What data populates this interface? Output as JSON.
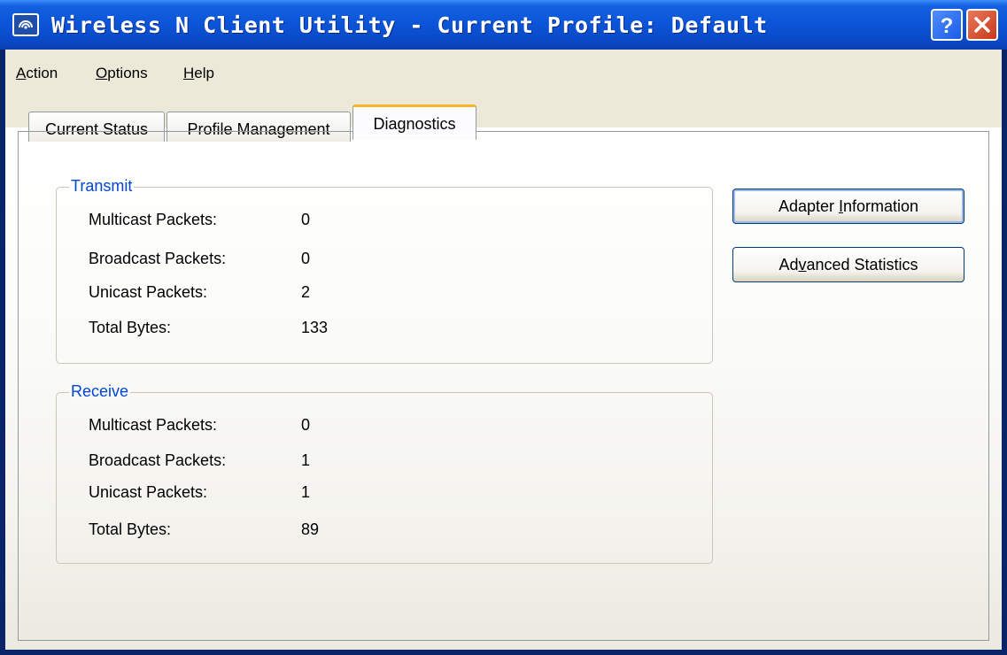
{
  "window": {
    "title": "Wireless N Client Utility - Current Profile: Default"
  },
  "menubar": [
    {
      "pre": "",
      "ul": "A",
      "post": "ction"
    },
    {
      "pre": "",
      "ul": "O",
      "post": "ptions"
    },
    {
      "pre": "",
      "ul": "H",
      "post": "elp"
    }
  ],
  "tabs": [
    "Current Status",
    "Profile Management",
    "Diagnostics"
  ],
  "active_tab": "Diagnostics",
  "transmit": {
    "legend": "Transmit",
    "rows": [
      {
        "label": "Multicast Packets:",
        "value": "0"
      },
      {
        "label": "Broadcast Packets:",
        "value": "0"
      },
      {
        "label": "Unicast Packets:",
        "value": "2"
      },
      {
        "label": "Total Bytes:",
        "value": "133"
      }
    ]
  },
  "receive": {
    "legend": "Receive",
    "rows": [
      {
        "label": "Multicast Packets:",
        "value": "0"
      },
      {
        "label": "Broadcast Packets:",
        "value": "1"
      },
      {
        "label": "Unicast Packets:",
        "value": "1"
      },
      {
        "label": "Total Bytes:",
        "value": "89"
      }
    ]
  },
  "buttons": {
    "adapter": {
      "pre": "Adapter ",
      "ul": "I",
      "post": "nformation"
    },
    "advanced": {
      "pre": "Ad",
      "ul": "v",
      "post": "anced Statistics"
    }
  },
  "icons": {
    "app": "wireless-signal-icon",
    "help": "question-mark-icon",
    "close": "close-x-icon"
  },
  "colors": {
    "titlebar": "#0a55d8",
    "accent_legend": "#0046d5",
    "tab_highlight": "#f7b529",
    "close": "#c8391a"
  }
}
